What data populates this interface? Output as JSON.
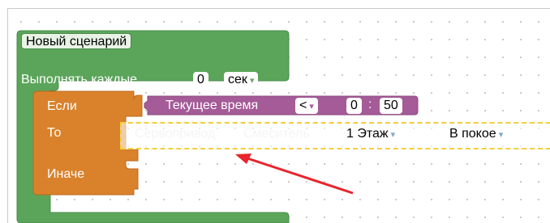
{
  "script": {
    "title": "Новый сценарий",
    "repeat_label": "Выполнять каждые",
    "repeat_value": "0",
    "repeat_unit": "сек"
  },
  "if_block": {
    "if_label": "Если",
    "then_label": "То",
    "else_label": "Иначе"
  },
  "condition": {
    "label": "Текущее время",
    "operator": "<",
    "hours": "0",
    "separator": ":",
    "minutes": "50"
  },
  "action": {
    "device_type": "Сервопривод",
    "device_name": "Смеситель",
    "floor": "1 Этаж",
    "state": "В покое"
  },
  "colors": {
    "green_block": "#5ba55a",
    "orange_block": "#d9822b",
    "purple_block": "#a55b98",
    "ghost_block_border": "#f3cf3a",
    "annotation_arrow": "#e8242c"
  },
  "icons": {
    "arrow": "red-annotation-arrow"
  }
}
